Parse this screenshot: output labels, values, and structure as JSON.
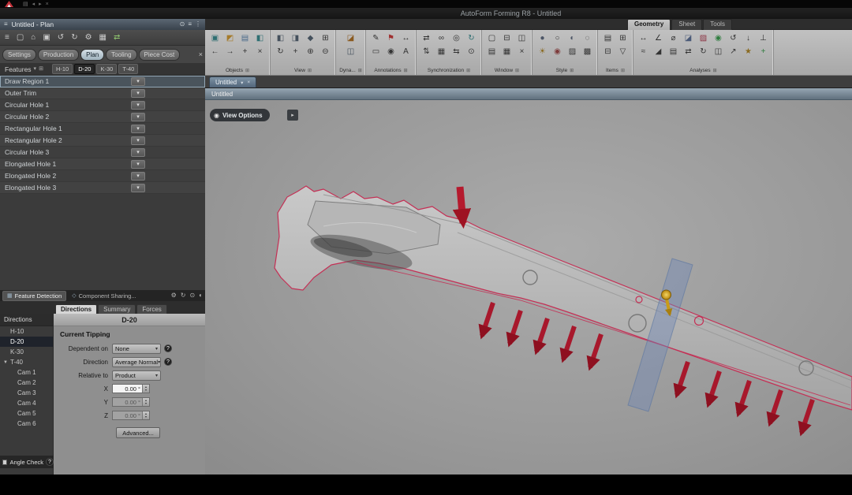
{
  "titlebar": {
    "title": "AutoForm Forming R8 - Untitled"
  },
  "top_strip": {
    "icons": [
      {
        "name": "app-menu-icon",
        "glyph": "▤",
        "color": "#6f6f6f"
      },
      {
        "name": "strip-back-icon",
        "glyph": "◂",
        "color": "#6f6f6f"
      },
      {
        "name": "strip-forward-icon",
        "glyph": "▸",
        "color": "#6f6f6f"
      },
      {
        "name": "strip-close-icon",
        "glyph": "×",
        "color": "#6f6f6f"
      }
    ]
  },
  "left_panel": {
    "header_title": "Untitled - Plan",
    "header_icons": [
      {
        "name": "pin-icon",
        "glyph": "⊙",
        "color": "#cfd6da"
      },
      {
        "name": "list-icon",
        "glyph": "≡",
        "color": "#cfd6da"
      },
      {
        "name": "more-icon",
        "glyph": "⋮",
        "color": "#cfd6da"
      }
    ],
    "toolbar_icons": [
      {
        "name": "menu-icon",
        "glyph": "≡"
      },
      {
        "name": "new-file-icon",
        "glyph": "▢"
      },
      {
        "name": "open-file-icon",
        "glyph": "⌂"
      },
      {
        "name": "save-icon",
        "glyph": "▣"
      },
      {
        "name": "undo-icon",
        "glyph": "↺"
      },
      {
        "name": "redo-icon",
        "glyph": "↻"
      },
      {
        "name": "settings-icon",
        "glyph": "⚙"
      },
      {
        "name": "layout-grid-icon",
        "glyph": "▦"
      },
      {
        "name": "sync-update-icon",
        "glyph": "⇄",
        "color": "#8fc56f"
      }
    ],
    "plan_tabs": [
      {
        "label": "Settings",
        "active": false
      },
      {
        "label": "Production",
        "active": false
      },
      {
        "label": "Plan",
        "active": true
      },
      {
        "label": "Tooling",
        "active": false
      },
      {
        "label": "Piece Cost",
        "active": false
      }
    ],
    "features": {
      "title": "Features",
      "op_glyph": "▾",
      "columns": [
        {
          "label": "H-10",
          "active": false
        },
        {
          "label": "D-20",
          "active": true
        },
        {
          "label": "K-30",
          "active": false
        },
        {
          "label": "T-40",
          "active": false
        }
      ],
      "items": [
        {
          "label": "Draw Region 1",
          "selected": true
        },
        {
          "label": "Outer Trim",
          "selected": false
        },
        {
          "label": "Circular Hole 1",
          "selected": false
        },
        {
          "label": "Circular Hole 2",
          "selected": false
        },
        {
          "label": "Rectangular Hole 1",
          "selected": false
        },
        {
          "label": "Rectangular Hole 2",
          "selected": false
        },
        {
          "label": "Circular Hole 3",
          "selected": false
        },
        {
          "label": "Elongated Hole 1",
          "selected": false
        },
        {
          "label": "Elongated Hole 2",
          "selected": false
        },
        {
          "label": "Elongated Hole 3",
          "selected": false
        }
      ]
    }
  },
  "ribbon": {
    "tabs": [
      {
        "label": "Geometry",
        "active": true
      },
      {
        "label": "Sheet",
        "active": false
      },
      {
        "label": "Tools",
        "active": false
      }
    ],
    "groups": [
      {
        "label": "Objects",
        "icons": [
          {
            "name": "tool-object-icon",
            "glyph": "▣",
            "color": "#2f6f72"
          },
          {
            "name": "geometry-object-icon",
            "glyph": "◩",
            "color": "#a57a2a"
          },
          {
            "name": "sheet-object-icon",
            "glyph": "▤",
            "color": "#4a6a8a"
          },
          {
            "name": "part-object-icon",
            "glyph": "◧",
            "color": "#2f6f72"
          },
          {
            "name": "prev-object-icon",
            "glyph": "←"
          },
          {
            "name": "next-object-icon",
            "glyph": "→"
          },
          {
            "name": "add-object-icon",
            "glyph": "+"
          },
          {
            "name": "delete-object-icon",
            "glyph": "×"
          }
        ]
      },
      {
        "label": "View",
        "icons": [
          {
            "name": "view-front-icon",
            "glyph": "◧",
            "color": "#44505c"
          },
          {
            "name": "view-top-icon",
            "glyph": "◨",
            "color": "#44505c"
          },
          {
            "name": "view-iso-icon",
            "glyph": "◆",
            "color": "#44505c"
          },
          {
            "name": "zoom-fit-icon",
            "glyph": "⊞"
          },
          {
            "name": "rotate-view-icon",
            "glyph": "↻"
          },
          {
            "name": "pan-view-icon",
            "glyph": "+"
          },
          {
            "name": "zoom-in-icon",
            "glyph": "⊕"
          },
          {
            "name": "zoom-out-icon",
            "glyph": "⊖"
          }
        ]
      },
      {
        "label": "Dyna...",
        "icons": [
          {
            "name": "dynamic-section-icon",
            "glyph": "◪",
            "color": "#8a5a20"
          },
          {
            "name": "clipping-plane-icon",
            "glyph": "◫",
            "color": "#44505c"
          }
        ]
      },
      {
        "label": "Annotations",
        "icons": [
          {
            "name": "note-icon",
            "glyph": "✎"
          },
          {
            "name": "flag-icon",
            "glyph": "⚑",
            "color": "#a03030"
          },
          {
            "name": "dimension-icon",
            "glyph": "↔"
          },
          {
            "name": "label-icon",
            "glyph": "▭"
          },
          {
            "name": "marker-icon",
            "glyph": "◉"
          },
          {
            "name": "text-annotation-icon",
            "glyph": "A"
          }
        ]
      },
      {
        "label": "Synchronization",
        "icons": [
          {
            "name": "sync-views-icon",
            "glyph": "⇄"
          },
          {
            "name": "sync-link-icon",
            "glyph": "∞"
          },
          {
            "name": "sync-camera-icon",
            "glyph": "◎"
          },
          {
            "name": "sync-refresh-icon",
            "glyph": "↻",
            "color": "#2f6f72"
          },
          {
            "name": "sync-vertical-icon",
            "glyph": "⇅"
          },
          {
            "name": "sync-grid-icon",
            "glyph": "▦"
          },
          {
            "name": "sync-swap-icon",
            "glyph": "⇆"
          },
          {
            "name": "sync-target-icon",
            "glyph": "⊙"
          }
        ]
      },
      {
        "label": "Window",
        "icons": [
          {
            "name": "new-window-icon",
            "glyph": "▢"
          },
          {
            "name": "split-horizontal-icon",
            "glyph": "⊟"
          },
          {
            "name": "split-vertical-icon",
            "glyph": "◫"
          },
          {
            "name": "cascade-windows-icon",
            "glyph": "▤"
          },
          {
            "name": "tile-windows-icon",
            "glyph": "▦"
          },
          {
            "name": "close-window-icon",
            "glyph": "×"
          }
        ]
      },
      {
        "label": "Style",
        "icons": [
          {
            "name": "shaded-style-icon",
            "glyph": "●",
            "color": "#4c5566"
          },
          {
            "name": "wireframe-style-icon",
            "glyph": "○"
          },
          {
            "name": "shaded-edges-icon",
            "glyph": "◐",
            "color": "#4c5566"
          },
          {
            "name": "transparent-style-icon",
            "glyph": "◌"
          },
          {
            "name": "lighting-icon",
            "glyph": "☀",
            "color": "#8a6a20"
          },
          {
            "name": "color-style-icon",
            "glyph": "◉",
            "color": "#7d3a3a"
          },
          {
            "name": "texture-style-icon",
            "glyph": "▨"
          },
          {
            "name": "edges-style-icon",
            "glyph": "▩"
          }
        ]
      },
      {
        "label": "Items",
        "icons": [
          {
            "name": "show-items-icon",
            "glyph": "▤"
          },
          {
            "name": "add-item-icon",
            "glyph": "⊞"
          },
          {
            "name": "hide-item-icon",
            "glyph": "⊟"
          },
          {
            "name": "filter-items-icon",
            "glyph": "▽"
          }
        ]
      },
      {
        "label": "Analyses",
        "icons": [
          {
            "name": "measure-distance-icon",
            "glyph": "↔"
          },
          {
            "name": "measure-angle-icon",
            "glyph": "∠"
          },
          {
            "name": "measure-radius-icon",
            "glyph": "⌀"
          },
          {
            "name": "section-analysis-icon",
            "glyph": "◪",
            "color": "#4a5a78"
          },
          {
            "name": "thinning-analysis-icon",
            "glyph": "▨",
            "color": "#8a3040"
          },
          {
            "name": "formability-icon",
            "glyph": "◉",
            "color": "#2f7d3f"
          },
          {
            "name": "springback-icon",
            "glyph": "↺"
          },
          {
            "name": "draw-depth-icon",
            "glyph": "↓"
          },
          {
            "name": "surface-normal-icon",
            "glyph": "⊥"
          },
          {
            "name": "curvature-icon",
            "glyph": "≈"
          },
          {
            "name": "undercut-icon",
            "glyph": "◢"
          },
          {
            "name": "report-icon",
            "glyph": "▤"
          },
          {
            "name": "compare-results-icon",
            "glyph": "⇄"
          },
          {
            "name": "history-icon",
            "glyph": "↻"
          },
          {
            "name": "result-chart-icon",
            "glyph": "◫"
          },
          {
            "name": "export-result-icon",
            "glyph": "↗"
          },
          {
            "name": "favorite-icon",
            "glyph": "★",
            "color": "#8a6a20"
          },
          {
            "name": "add-analysis-icon",
            "glyph": "+",
            "color": "#2f7d3f"
          }
        ]
      }
    ]
  },
  "viewport": {
    "doc_tab": "Untitled",
    "caption": "Untitled",
    "view_options_label": "View Options"
  },
  "scene": {
    "outline_color": "#c43055",
    "arrow_color": "#a8182c",
    "arrow_head_color": "#8e1020",
    "big_arrow_color": "#b51a2e",
    "plane_color": "#7089b8",
    "pin_color": "#d4a017"
  },
  "bottom_panel": {
    "tabs": [
      {
        "label": "Feature Detection",
        "active": true
      },
      {
        "label": "Component Sharing...",
        "active": false
      }
    ],
    "bar_icons": [
      {
        "name": "detect-settings-icon",
        "glyph": "⚙",
        "color": "#b5b5b5"
      },
      {
        "name": "detect-refresh-icon",
        "glyph": "↻",
        "color": "#b5b5b5"
      },
      {
        "name": "detect-target-icon",
        "glyph": "⊙",
        "color": "#b5b5b5"
      },
      {
        "name": "detect-palette-icon",
        "glyph": "◐",
        "color": "#b5b5b5"
      }
    ],
    "subtabs": [
      {
        "label": "Directions",
        "active": true
      },
      {
        "label": "Summary",
        "active": false
      },
      {
        "label": "Forces",
        "active": false
      }
    ],
    "panel_title": "D-20",
    "sidebar": {
      "header": "Directions",
      "items": [
        {
          "label": "H-10",
          "selected": false,
          "indent": false,
          "expander": ""
        },
        {
          "label": "D-20",
          "selected": true,
          "indent": false,
          "expander": ""
        },
        {
          "label": "K-30",
          "selected": false,
          "indent": false,
          "expander": ""
        },
        {
          "label": "T-40",
          "selected": false,
          "indent": false,
          "expander": "▼"
        },
        {
          "label": "Cam 1",
          "selected": false,
          "indent": true,
          "expander": ""
        },
        {
          "label": "Cam 2",
          "selected": false,
          "indent": true,
          "expander": ""
        },
        {
          "label": "Cam 3",
          "selected": false,
          "indent": true,
          "expander": ""
        },
        {
          "label": "Cam 4",
          "selected": false,
          "indent": true,
          "expander": ""
        },
        {
          "label": "Cam 5",
          "selected": false,
          "indent": true,
          "expander": ""
        },
        {
          "label": "Cam 6",
          "selected": false,
          "indent": true,
          "expander": ""
        }
      ]
    },
    "tipping": {
      "section_title": "Current Tipping",
      "fields": [
        {
          "label": "Dependent on",
          "value": "None",
          "help": true
        },
        {
          "label": "Direction",
          "value": "Average Normal",
          "help": true
        },
        {
          "label": "Relative to",
          "value": "Product",
          "help": false
        }
      ],
      "angles": [
        {
          "label": "X",
          "value": "0.00 °",
          "enabled": true
        },
        {
          "label": "Y",
          "value": "0.00 °",
          "enabled": false
        },
        {
          "label": "Z",
          "value": "0.00 °",
          "enabled": false
        }
      ],
      "advanced_label": "Advanced..."
    },
    "angle_check_label": "Angle Check"
  }
}
